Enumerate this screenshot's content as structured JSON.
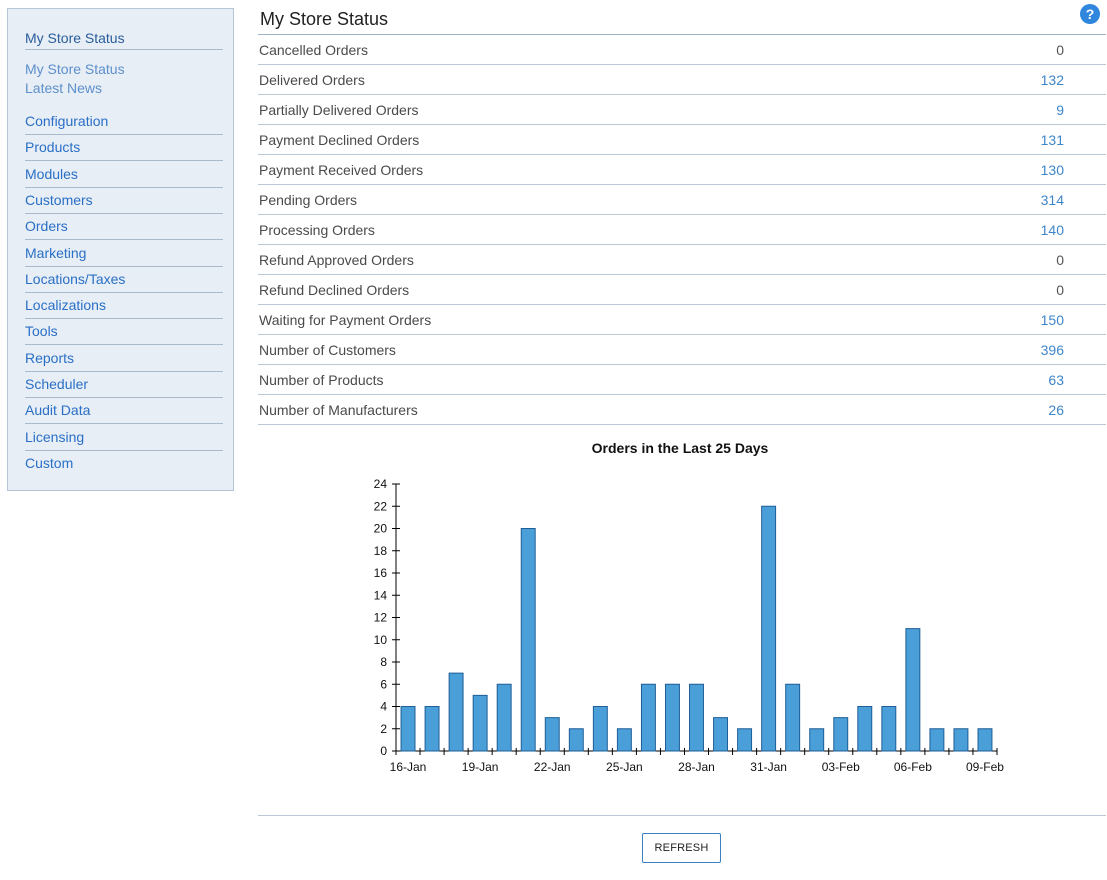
{
  "sidebar": {
    "header": "My Store Status",
    "sub_links": [
      "My Store Status",
      "Latest News"
    ],
    "items": [
      {
        "label": "Configuration"
      },
      {
        "label": "Products"
      },
      {
        "label": "Modules"
      },
      {
        "label": "Customers"
      },
      {
        "label": "Orders"
      },
      {
        "label": "Marketing"
      },
      {
        "label": "Locations/Taxes"
      },
      {
        "label": "Localizations"
      },
      {
        "label": "Tools"
      },
      {
        "label": "Reports"
      },
      {
        "label": "Scheduler"
      },
      {
        "label": "Audit Data"
      },
      {
        "label": "Licensing"
      },
      {
        "label": "Custom"
      }
    ]
  },
  "main": {
    "title": "My Store Status",
    "help_icon": "?",
    "stats": [
      {
        "label": "Cancelled Orders",
        "value": "0"
      },
      {
        "label": "Delivered Orders",
        "value": "132"
      },
      {
        "label": "Partially Delivered Orders",
        "value": "9"
      },
      {
        "label": "Payment Declined Orders",
        "value": "131"
      },
      {
        "label": "Payment Received Orders",
        "value": "130"
      },
      {
        "label": "Pending Orders",
        "value": "314"
      },
      {
        "label": "Processing Orders",
        "value": "140"
      },
      {
        "label": "Refund Approved Orders",
        "value": "0"
      },
      {
        "label": "Refund Declined Orders",
        "value": "0"
      },
      {
        "label": "Waiting for Payment Orders",
        "value": "150"
      },
      {
        "label": "Number of Customers",
        "value": "396"
      },
      {
        "label": "Number of Products",
        "value": "63"
      },
      {
        "label": "Number of Manufacturers",
        "value": "26"
      }
    ],
    "refresh_label": "REFRESH"
  },
  "colors": {
    "link": "#2a6fc6",
    "bar_fill": "#4a9fd8",
    "bar_stroke": "#1f5e96",
    "help_icon": "#2f86dc"
  },
  "chart_data": {
    "type": "bar",
    "title": "Orders in the Last 25 Days",
    "xlabel": "",
    "ylabel": "",
    "ylim": [
      0,
      24
    ],
    "yticks": [
      0,
      2,
      4,
      6,
      8,
      10,
      12,
      14,
      16,
      18,
      20,
      22,
      24
    ],
    "categories": [
      "16-Jan",
      "17-Jan",
      "18-Jan",
      "19-Jan",
      "20-Jan",
      "21-Jan",
      "22-Jan",
      "23-Jan",
      "24-Jan",
      "25-Jan",
      "26-Jan",
      "27-Jan",
      "28-Jan",
      "29-Jan",
      "30-Jan",
      "31-Jan",
      "01-Feb",
      "02-Feb",
      "03-Feb",
      "04-Feb",
      "05-Feb",
      "06-Feb",
      "07-Feb",
      "08-Feb",
      "09-Feb"
    ],
    "tick_labels": [
      "16-Jan",
      "19-Jan",
      "22-Jan",
      "25-Jan",
      "28-Jan",
      "31-Jan",
      "03-Feb",
      "06-Feb",
      "09-Feb"
    ],
    "values": [
      4,
      4,
      7,
      5,
      6,
      20,
      3,
      2,
      4,
      2,
      6,
      6,
      6,
      3,
      2,
      22,
      6,
      2,
      3,
      4,
      4,
      11,
      2,
      2,
      2
    ],
    "grid": false
  }
}
